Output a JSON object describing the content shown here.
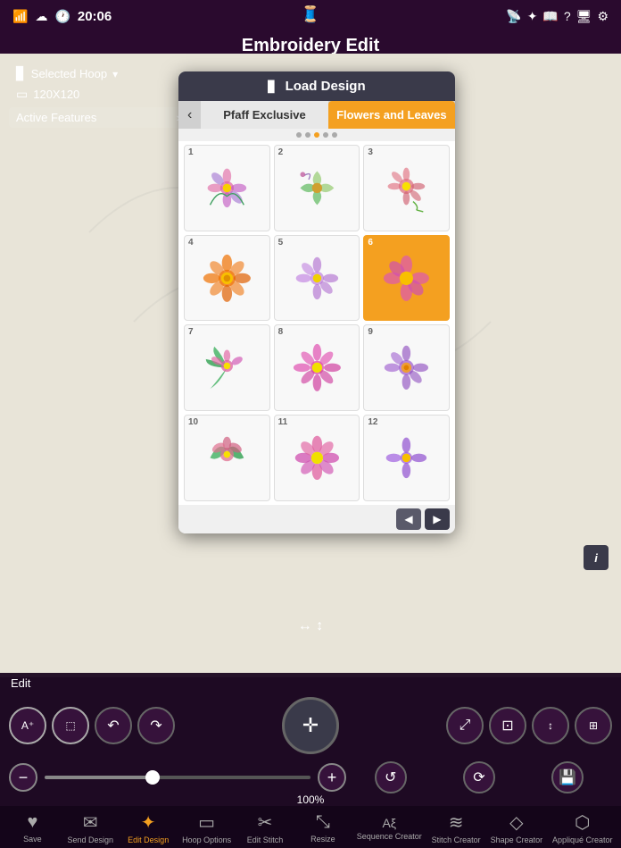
{
  "app": {
    "title": "Embroidery Edit",
    "time": "20:06"
  },
  "left_panel": {
    "selected_hoop_label": "Selected Hoop",
    "hoop_size": "120X120",
    "active_features_label": "Active Features"
  },
  "modal": {
    "title": "Load Design",
    "tab1": "Pfaff Exclusive",
    "tab2": "Flowers and Leaves",
    "designs": [
      {
        "num": "1",
        "selected": false
      },
      {
        "num": "2",
        "selected": false
      },
      {
        "num": "3",
        "selected": false
      },
      {
        "num": "4",
        "selected": false
      },
      {
        "num": "5",
        "selected": false
      },
      {
        "num": "6",
        "selected": true
      },
      {
        "num": "7",
        "selected": false
      },
      {
        "num": "8",
        "selected": false
      },
      {
        "num": "9",
        "selected": false
      },
      {
        "num": "10",
        "selected": false
      },
      {
        "num": "11",
        "selected": false
      },
      {
        "num": "12",
        "selected": false
      }
    ]
  },
  "toolbar": {
    "edit_label": "Edit",
    "zoom_pct": "100%"
  },
  "bottom_nav": [
    {
      "label": "Save",
      "icon": "♥",
      "active": false
    },
    {
      "label": "Send Design",
      "icon": "✉",
      "active": false
    },
    {
      "label": "Edit Design",
      "icon": "✦",
      "active": true
    },
    {
      "label": "Hoop Options",
      "icon": "▭",
      "active": false
    },
    {
      "label": "Edit Stitch",
      "icon": "✂",
      "active": false
    },
    {
      "label": "Resize",
      "icon": "⤡",
      "active": false
    },
    {
      "label": "Sequence Creator",
      "icon": "Aξ",
      "active": false
    },
    {
      "label": "Stitch Creator",
      "icon": "≋",
      "active": false
    },
    {
      "label": "Shape Creator",
      "icon": "◇",
      "active": false
    },
    {
      "label": "Appliqué Creator",
      "icon": "⬡",
      "active": false
    }
  ]
}
